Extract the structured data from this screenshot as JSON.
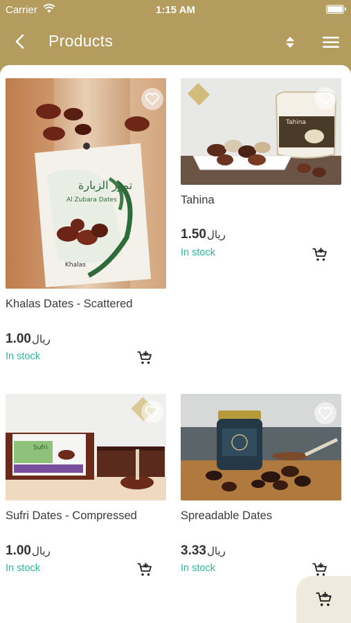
{
  "status_bar": {
    "carrier": "Carrier",
    "time": "1:15 AM"
  },
  "navbar": {
    "title": "Products"
  },
  "products": [
    {
      "name": "Khalas Dates - Scattered",
      "price": "1.00",
      "currency": "ريال",
      "stock": "In stock"
    },
    {
      "name": "Tahina",
      "price": "1.50",
      "currency": "ريال",
      "stock": "In stock"
    },
    {
      "name": "Sufri Dates - Compressed",
      "price": "1.00",
      "currency": "ريال",
      "stock": "In stock"
    },
    {
      "name": "Spreadable Dates",
      "price": "3.33",
      "currency": "ريال",
      "stock": "In stock"
    }
  ],
  "colors": {
    "header": "#b39c5e",
    "stock": "#2db89a",
    "fab_bg": "#efe9de"
  },
  "icons": {
    "back": "chevron-left-icon",
    "sort": "sort-icon",
    "menu": "hamburger-menu-icon",
    "favorite": "heart-outline-icon",
    "cart": "add-to-cart-icon",
    "wifi": "wifi-icon",
    "battery": "battery-icon"
  }
}
